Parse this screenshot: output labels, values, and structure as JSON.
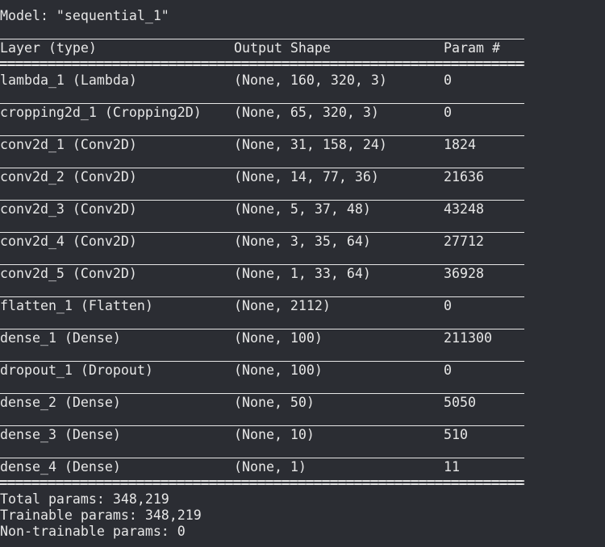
{
  "model_line": "Model: \"sequential_1\"",
  "headers": {
    "layer": "Layer (type)",
    "output": "Output Shape",
    "params": "Param #"
  },
  "rows": [
    {
      "layer": "lambda_1 (Lambda)",
      "output": "(None, 160, 320, 3)",
      "params": "0"
    },
    {
      "layer": "cropping2d_1 (Cropping2D)",
      "output": "(None, 65, 320, 3)",
      "params": "0"
    },
    {
      "layer": "conv2d_1 (Conv2D)",
      "output": "(None, 31, 158, 24)",
      "params": "1824"
    },
    {
      "layer": "conv2d_2 (Conv2D)",
      "output": "(None, 14, 77, 36)",
      "params": "21636"
    },
    {
      "layer": "conv2d_3 (Conv2D)",
      "output": "(None, 5, 37, 48)",
      "params": "43248"
    },
    {
      "layer": "conv2d_4 (Conv2D)",
      "output": "(None, 3, 35, 64)",
      "params": "27712"
    },
    {
      "layer": "conv2d_5 (Conv2D)",
      "output": "(None, 1, 33, 64)",
      "params": "36928"
    },
    {
      "layer": "flatten_1 (Flatten)",
      "output": "(None, 2112)",
      "params": "0"
    },
    {
      "layer": "dense_1 (Dense)",
      "output": "(None, 100)",
      "params": "211300"
    },
    {
      "layer": "dropout_1 (Dropout)",
      "output": "(None, 100)",
      "params": "0"
    },
    {
      "layer": "dense_2 (Dense)",
      "output": "(None, 50)",
      "params": "5050"
    },
    {
      "layer": "dense_3 (Dense)",
      "output": "(None, 10)",
      "params": "510"
    },
    {
      "layer": "dense_4 (Dense)",
      "output": "(None, 1)",
      "params": "11"
    }
  ],
  "summary": {
    "total": "Total params: 348,219",
    "trainable": "Trainable params: 348,219",
    "non_trainable": "Non-trainable params: 0"
  }
}
